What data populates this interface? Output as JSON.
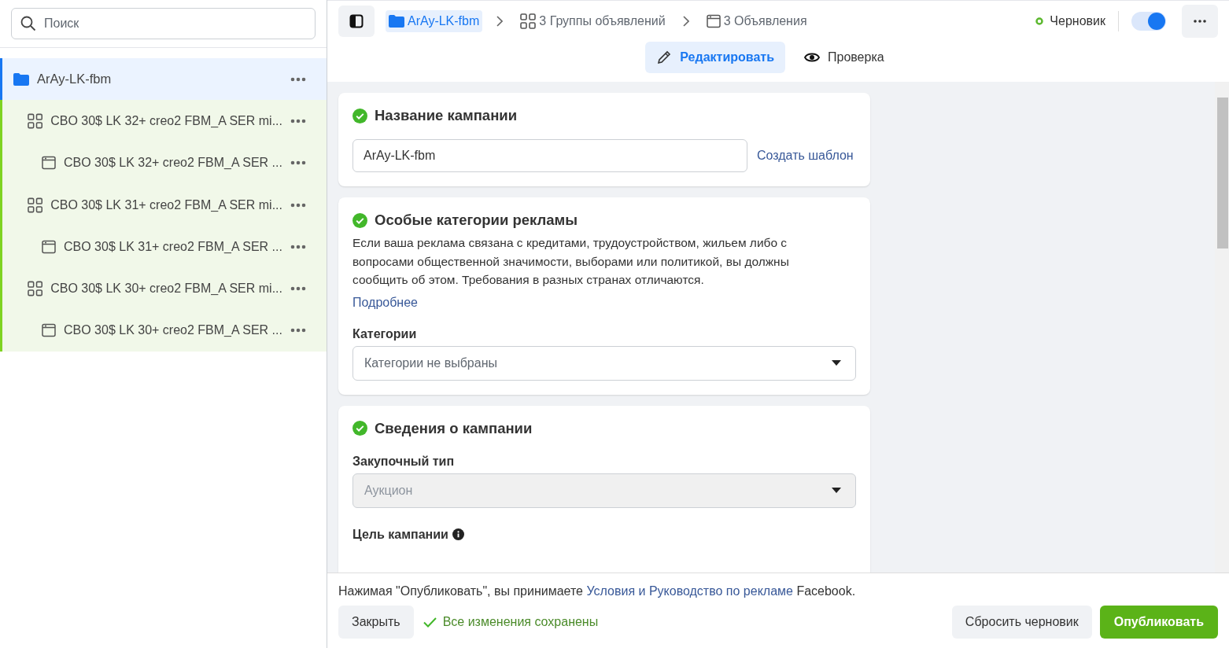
{
  "sidebar": {
    "search": {
      "placeholder": "Поиск"
    },
    "tree": [
      {
        "kind": "campaign",
        "label": "ArAy-LK-fbm",
        "selected": true,
        "children": [
          {
            "kind": "adset",
            "label": "CBO 30$ LK 32+ creo2 FBM_A SER mi...",
            "selected": false,
            "children": [
              {
                "kind": "ad",
                "label": "CBO 30$ LK 32+ creo2 FBM_A SER ...",
                "selected": false
              }
            ]
          },
          {
            "kind": "adset",
            "label": "CBO 30$ LK 31+ creo2 FBM_A SER mi...",
            "selected": false,
            "children": [
              {
                "kind": "ad",
                "label": "CBO 30$ LK 31+ creo2 FBM_A SER ...",
                "selected": false
              }
            ]
          },
          {
            "kind": "adset",
            "label": "CBO 30$ LK 30+ creo2 FBM_A SER mi...",
            "selected": false,
            "children": [
              {
                "kind": "ad",
                "label": "CBO 30$ LK 30+ creo2 FBM_A SER ...",
                "selected": false
              }
            ]
          }
        ]
      }
    ]
  },
  "breadcrumbs": [
    {
      "kind": "campaign",
      "label": "ArAy-LK-fbm",
      "selected": true
    },
    {
      "kind": "adset",
      "label": "3 Группы объявлений",
      "selected": false
    },
    {
      "kind": "ad",
      "label": "3 Объявления",
      "selected": false
    }
  ],
  "status": {
    "label": "Черновик",
    "color": "#5cb82f"
  },
  "toggle": {
    "on": true
  },
  "mode_tabs": [
    {
      "kind": "edit",
      "label": "Редактировать",
      "selected": true
    },
    {
      "kind": "review",
      "label": "Проверка",
      "selected": false
    }
  ],
  "campaign_name": {
    "title": "Название кампании",
    "complete": true,
    "value": "ArAy-LK-fbm",
    "link": "Создать шаблон"
  },
  "special_categories": {
    "title": "Особые категории рекламы",
    "complete": true,
    "description": "Если ваша реклама связана с кредитами, трудоустройством, жильем либо с вопросами общественной значимости, выборами или политикой, вы должны сообщить об этом. Требования в разных странах отличаются.",
    "link": "Подробнее",
    "label": "Категории",
    "select": {
      "placeholder": "Категории не выбраны",
      "disabled": false
    }
  },
  "campaign_details": {
    "title": "Сведения о кампании",
    "complete": true,
    "buying_type": {
      "label": "Закупочный тип",
      "value": "Аукцион",
      "disabled": true
    },
    "objective": {
      "label": "Цель кампании"
    }
  },
  "footer": {
    "notice_before": "Нажимая \"Опубликовать\", вы принимаете ",
    "notice_link": "Условия и Руководство по рекламе",
    "notice_after": " Facebook.",
    "close": "Закрыть",
    "saved": "Все изменения сохранены",
    "discard": "Сбросить черновик",
    "publish": "Опубликовать"
  }
}
